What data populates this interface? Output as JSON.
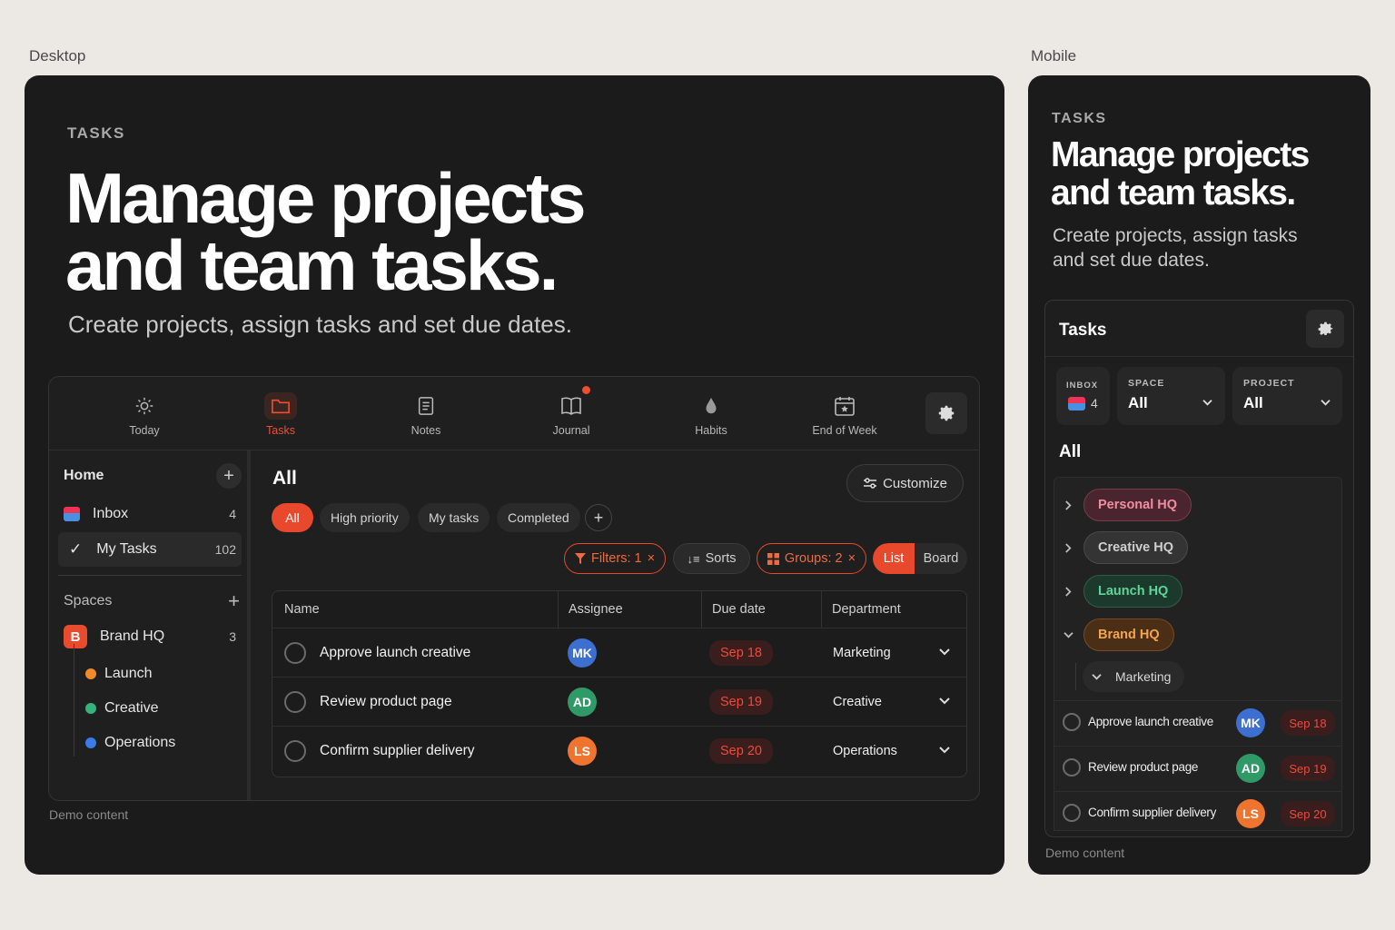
{
  "labels": {
    "desktop": "Desktop",
    "mobile": "Mobile",
    "demo": "Demo content"
  },
  "hero": {
    "kicker": "TASKS",
    "title_line1": "Manage projects",
    "title_line2": "and team tasks.",
    "subtitle": "Create projects, assign tasks and set due dates.",
    "mobile_subtitle_line1": "Create projects, assign tasks",
    "mobile_subtitle_line2": "and set due dates."
  },
  "nav": [
    {
      "label": "Today",
      "icon": "sun-icon"
    },
    {
      "label": "Tasks",
      "icon": "folder-icon",
      "active": true
    },
    {
      "label": "Notes",
      "icon": "notes-icon"
    },
    {
      "label": "Journal",
      "icon": "book-icon",
      "badge": true
    },
    {
      "label": "Habits",
      "icon": "drop-icon"
    },
    {
      "label": "End of Week",
      "icon": "calendar-star-icon"
    }
  ],
  "sidebar": {
    "home": "Home",
    "inbox": {
      "label": "Inbox",
      "count": "4"
    },
    "my_tasks": {
      "label": "My Tasks",
      "count": "102"
    },
    "spaces": "Spaces",
    "space": {
      "badge": "B",
      "label": "Brand HQ",
      "count": "3"
    },
    "projects": [
      {
        "label": "Launch",
        "color": "#f08a2a"
      },
      {
        "label": "Creative",
        "color": "#34b37a"
      },
      {
        "label": "Operations",
        "color": "#3b7be8"
      }
    ]
  },
  "main": {
    "title": "All",
    "customize": "Customize",
    "chips": [
      "All",
      "High priority",
      "My tasks",
      "Completed"
    ],
    "filters": "Filters: 1",
    "sorts": "Sorts",
    "groups": "Groups: 2",
    "view_list": "List",
    "view_board": "Board",
    "columns": [
      "Name",
      "Assignee",
      "Due date",
      "Department"
    ]
  },
  "tasks": [
    {
      "name": "Approve launch creative",
      "initials": "MK",
      "avatar_color": "#3d6fd1",
      "due": "Sep 18",
      "dept": "Marketing"
    },
    {
      "name": "Review product page",
      "initials": "AD",
      "avatar_color": "#2f9a68",
      "due": "Sep 19",
      "dept": "Creative"
    },
    {
      "name": "Confirm supplier delivery",
      "initials": "LS",
      "avatar_color": "#ee7430",
      "due": "Sep 20",
      "dept": "Operations"
    }
  ],
  "mobile": {
    "header": "Tasks",
    "inbox_key": "INBOX",
    "inbox_count": "4",
    "space_key": "SPACE",
    "space_value": "All",
    "project_key": "PROJECT",
    "project_value": "All",
    "section": "All",
    "groups": [
      {
        "label": "Personal HQ",
        "bg": "#4a2530",
        "fg": "#f08ea0",
        "border": "#7a3a4a"
      },
      {
        "label": "Creative HQ",
        "bg": "#343434",
        "fg": "#cfcfcf",
        "border": "#4a4a4a"
      },
      {
        "label": "Launch HQ",
        "bg": "#1c3a2c",
        "fg": "#5fd49a",
        "border": "#2f5e45"
      },
      {
        "label": "Brand HQ",
        "bg": "#4a2e16",
        "fg": "#f3a44f",
        "border": "#7a4a22"
      }
    ],
    "subgroup": "Marketing"
  },
  "colors": {
    "accent": "#ec4b2c",
    "panel": "#1b1b1b",
    "background": "#ece9e4"
  }
}
